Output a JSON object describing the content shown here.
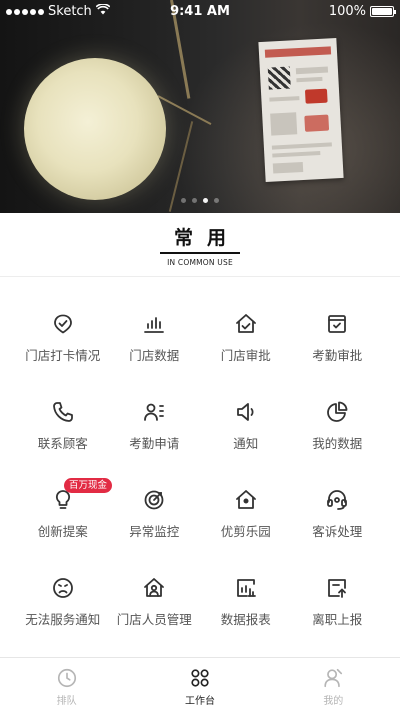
{
  "status_bar": {
    "carrier": "Sketch",
    "time": "9:41 AM",
    "battery": "100%"
  },
  "banner": {
    "slide_count": 4,
    "active_slide": 3
  },
  "section": {
    "title": "常用",
    "subtitle": "IN COMMON USE"
  },
  "grid": {
    "items": [
      {
        "label": "门店打卡情况",
        "icon": "check-circle-icon"
      },
      {
        "label": "门店数据",
        "icon": "bar-chart-icon"
      },
      {
        "label": "门店审批",
        "icon": "home-check-icon"
      },
      {
        "label": "考勤审批",
        "icon": "inbox-check-icon"
      },
      {
        "label": "联系顾客",
        "icon": "phone-icon"
      },
      {
        "label": "考勤申请",
        "icon": "user-list-icon"
      },
      {
        "label": "通知",
        "icon": "speaker-icon"
      },
      {
        "label": "我的数据",
        "icon": "pie-chart-icon"
      },
      {
        "label": "创新提案",
        "icon": "lightbulb-icon",
        "badge": "百万现金"
      },
      {
        "label": "异常监控",
        "icon": "target-icon"
      },
      {
        "label": "优剪乐园",
        "icon": "house-icon"
      },
      {
        "label": "客诉处理",
        "icon": "headset-icon"
      },
      {
        "label": "无法服务通知",
        "icon": "sad-face-icon"
      },
      {
        "label": "门店人员管理",
        "icon": "house-user-icon"
      },
      {
        "label": "数据报表",
        "icon": "report-icon"
      },
      {
        "label": "离职上报",
        "icon": "upload-doc-icon"
      }
    ]
  },
  "tabbar": {
    "tabs": [
      {
        "label": "排队",
        "icon": "clock-icon",
        "active": false
      },
      {
        "label": "工作台",
        "icon": "grid-icon",
        "active": true
      },
      {
        "label": "我的",
        "icon": "person-icon",
        "active": false
      }
    ]
  },
  "colors": {
    "badge": "#e22b44",
    "icon": "#333333",
    "label": "#555555",
    "tab_inactive": "#b5b5b5"
  }
}
